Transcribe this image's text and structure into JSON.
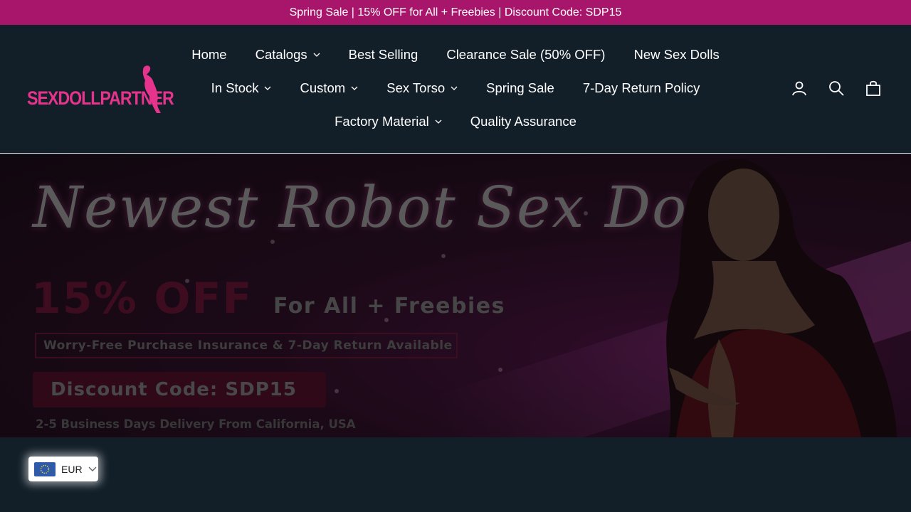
{
  "announcement": "Spring Sale | 15% OFF for All + Freebies | Discount Code: SDP15",
  "logo": {
    "text": "SEXDOLLPARTNER",
    "color": "#e6348d"
  },
  "nav": {
    "row1": [
      {
        "label": "Home",
        "dropdown": false
      },
      {
        "label": "Catalogs",
        "dropdown": true
      },
      {
        "label": "Best Selling",
        "dropdown": false
      },
      {
        "label": "Clearance Sale (50% OFF)",
        "dropdown": false
      },
      {
        "label": "New Sex Dolls",
        "dropdown": false
      }
    ],
    "row2": [
      {
        "label": "In Stock",
        "dropdown": true
      },
      {
        "label": "Custom",
        "dropdown": true
      },
      {
        "label": "Sex Torso",
        "dropdown": true
      },
      {
        "label": "Spring Sale",
        "dropdown": false
      },
      {
        "label": "7-Day Return Policy",
        "dropdown": false
      }
    ],
    "row3": [
      {
        "label": "Factory Material",
        "dropdown": true
      },
      {
        "label": "Quality Assurance",
        "dropdown": false
      }
    ]
  },
  "header_icons": [
    "account-icon",
    "search-icon",
    "cart-icon"
  ],
  "hero": {
    "title": "Newest Robot Sex Doll",
    "off": "15% OFF",
    "freebies": "For All + Freebies",
    "insurance": "Worry-Free Purchase Insurance & 7-Day Return Available",
    "code": "Discount Code: SDP15",
    "delivery": "2-5 Business Days Delivery From California, USA"
  },
  "currency": {
    "code": "EUR",
    "flag": "eu-flag-icon"
  },
  "colors": {
    "announce_bg": "#a8166b",
    "header_bg": "#121e28",
    "accent": "#e6348d"
  }
}
